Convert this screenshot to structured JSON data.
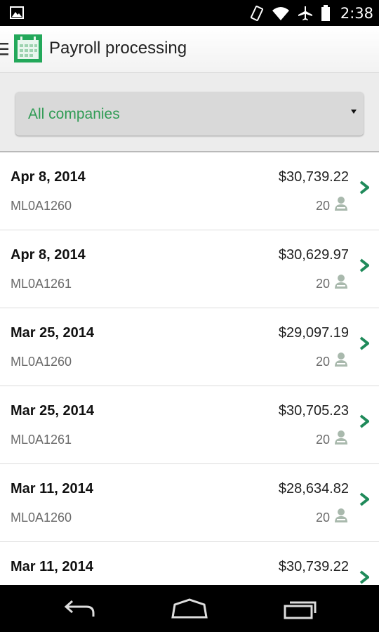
{
  "status_bar": {
    "time": "2:38"
  },
  "header": {
    "title": "Payroll processing"
  },
  "filter": {
    "selected": "All companies"
  },
  "payrolls": [
    {
      "date": "Apr 8, 2014",
      "code": "ML0A1260",
      "amount": "$30,739.22",
      "employees": "20"
    },
    {
      "date": "Apr 8, 2014",
      "code": "ML0A1261",
      "amount": "$30,629.97",
      "employees": "20"
    },
    {
      "date": "Mar 25, 2014",
      "code": "ML0A1260",
      "amount": "$29,097.19",
      "employees": "20"
    },
    {
      "date": "Mar 25, 2014",
      "code": "ML0A1261",
      "amount": "$30,705.23",
      "employees": "20"
    },
    {
      "date": "Mar 11, 2014",
      "code": "ML0A1260",
      "amount": "$28,634.82",
      "employees": "20"
    },
    {
      "date": "Mar 11, 2014",
      "code": "",
      "amount": "$30,739.22",
      "employees": ""
    }
  ],
  "colors": {
    "accent": "#2f9b54",
    "chevron": "#1f8a5a"
  },
  "icons": [
    "picture-icon",
    "rotate-icon",
    "wifi-icon",
    "airplane-icon",
    "battery-icon",
    "hamburger-icon",
    "payroll-app-icon",
    "dropdown-arrow-icon",
    "person-icon",
    "chevron-right-icon",
    "back-icon",
    "home-icon",
    "recents-icon"
  ]
}
